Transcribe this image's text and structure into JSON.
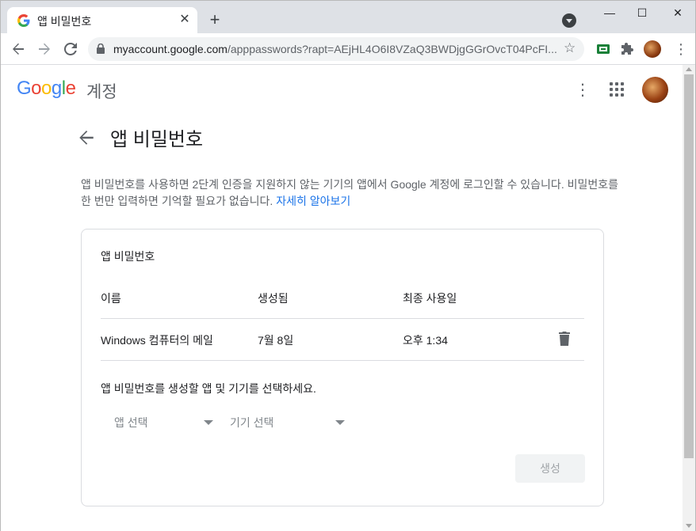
{
  "browser": {
    "tab_title": "앱 비밀번호",
    "tab_close": "✕",
    "new_tab": "+",
    "url_host": "myaccount.google.com",
    "url_path": "/apppasswords?rapt=AEjHL4O6I8VZaQ3BWDjgGGrOvcT04PcFI...",
    "window_min": "—",
    "window_max": "☐",
    "window_close": "✕"
  },
  "header": {
    "logo_letters": [
      "G",
      "o",
      "o",
      "g",
      "l",
      "e"
    ],
    "logo_colors": [
      "#4285F4",
      "#EA4335",
      "#FBBC05",
      "#4285F4",
      "#34A853",
      "#EA4335"
    ],
    "account_label": "계정"
  },
  "page": {
    "title": "앱 비밀번호",
    "description": "앱 비밀번호를 사용하면 2단계 인증을 지원하지 않는 기기의 앱에서 Google 계정에 로그인할 수 있습니다. 비밀번호를 한 번만 입력하면 기억할 필요가 없습니다.",
    "learn_more": "자세히 알아보기"
  },
  "card": {
    "title": "앱 비밀번호",
    "columns": [
      "이름",
      "생성됨",
      "최종 사용일"
    ],
    "rows": [
      {
        "name": "Windows 컴퓨터의 메일",
        "created": "7월 8일",
        "last_used": "오후 1:34"
      }
    ],
    "instructions": "앱 비밀번호를 생성할 앱 및 기기를 선택하세요.",
    "select_app": "앱 선택",
    "select_device": "기기 선택",
    "generate_button": "생성"
  },
  "colors": {
    "link": "#1a73e8",
    "text_primary": "#202124",
    "text_secondary": "#5f6368"
  }
}
